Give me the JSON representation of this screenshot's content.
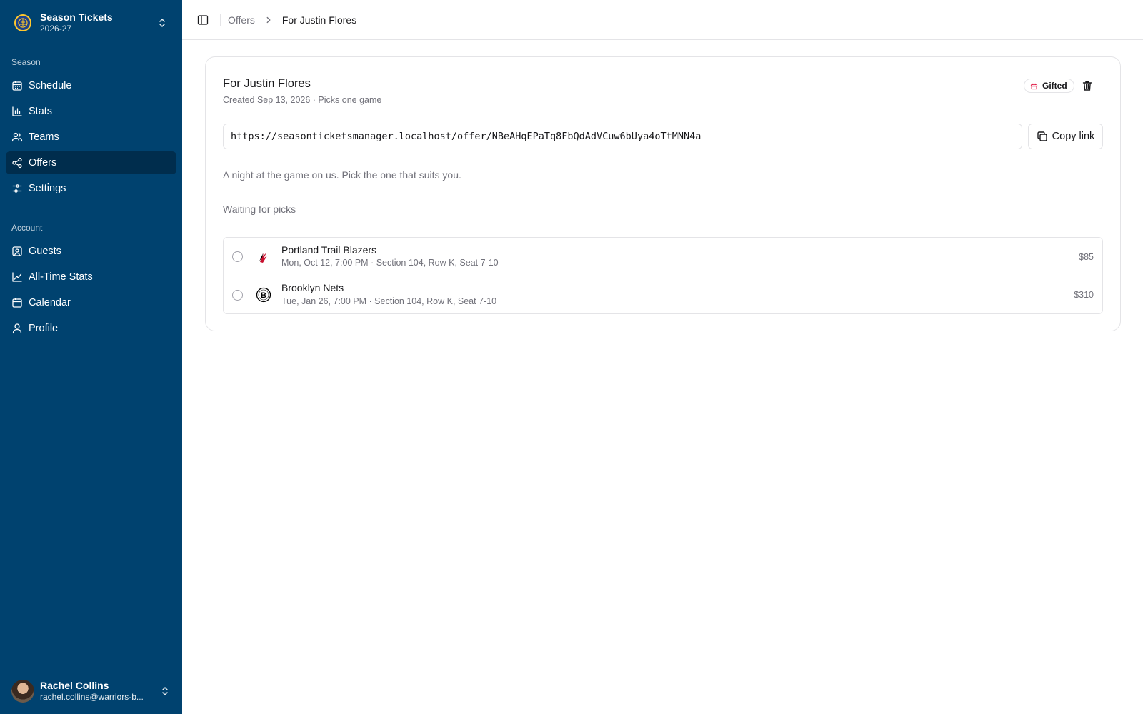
{
  "sidebar": {
    "team": {
      "name": "Season Tickets",
      "season": "2026-27"
    },
    "groups": [
      {
        "label": "Season",
        "items": [
          {
            "label": "Schedule",
            "icon": "calendar-days-icon",
            "active": false
          },
          {
            "label": "Stats",
            "icon": "bar-chart-icon",
            "active": false
          },
          {
            "label": "Teams",
            "icon": "users-icon",
            "active": false
          },
          {
            "label": "Offers",
            "icon": "share-icon",
            "active": true
          },
          {
            "label": "Settings",
            "icon": "sliders-icon",
            "active": false
          }
        ]
      },
      {
        "label": "Account",
        "items": [
          {
            "label": "Guests",
            "icon": "contact-icon",
            "active": false
          },
          {
            "label": "All-Time Stats",
            "icon": "line-chart-icon",
            "active": false
          },
          {
            "label": "Calendar",
            "icon": "calendar-icon",
            "active": false
          },
          {
            "label": "Profile",
            "icon": "user-icon",
            "active": false
          }
        ]
      }
    ],
    "user": {
      "name": "Rachel Collins",
      "email": "rachel.collins@warriors-b..."
    }
  },
  "header": {
    "breadcrumb": {
      "parent": "Offers",
      "current": "For Justin Flores"
    }
  },
  "offer": {
    "title": "For Justin Flores",
    "subtitle": "Created Sep 13, 2026 · Picks one game",
    "badge": "Gifted",
    "url": "https://seasonticketsmanager.localhost/offer/NBeAHqEPaTq8FbQdAdVCuw6bUya4oTtMNN4a",
    "copy_label": "Copy link",
    "message": "A night at the game on us. Pick the one that suits you.",
    "status": "Waiting for picks",
    "games": [
      {
        "team": "Portland Trail Blazers",
        "detail": "Mon, Oct 12, 7:00 PM · Section 104, Row K, Seat 7-10",
        "price": "$85",
        "logo": "trail-blazers-logo",
        "selected": false
      },
      {
        "team": "Brooklyn Nets",
        "detail": "Tue, Jan 26, 7:00 PM · Section 104, Row K, Seat 7-10",
        "price": "$310",
        "logo": "nets-logo",
        "selected": false
      }
    ]
  },
  "colors": {
    "sidebar_bg": "#00426f",
    "active_bg": "#002d4d",
    "badge_icon": "#e11d48"
  }
}
